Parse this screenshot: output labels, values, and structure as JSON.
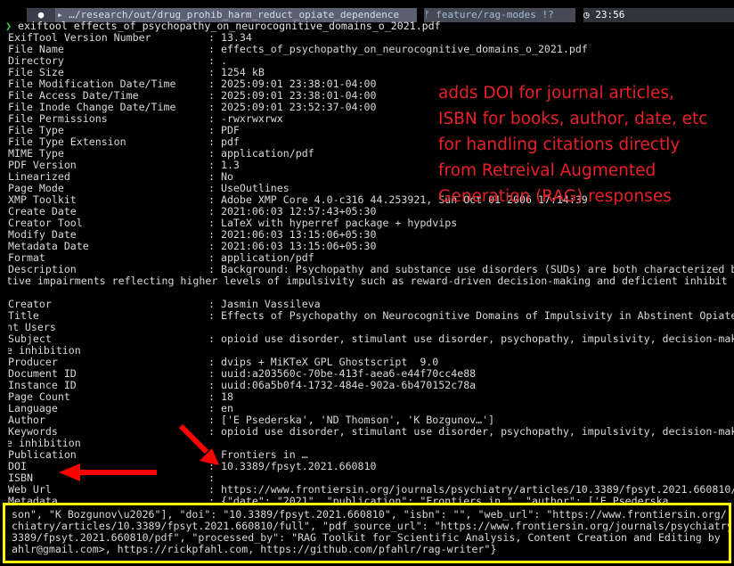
{
  "prompt_bar": {
    "os_icon": "apple-icon",
    "path": "…/research/out/drug_prohib_harm_reduct_opiate_dependence",
    "git": "feature/rag-modes !?",
    "git_icon": "branch-icon",
    "time": "23:56",
    "clock_icon": "clock-icon"
  },
  "command": {
    "prompt_char": "❯",
    "text": "exiftool effects_of_psychopathy_on_neurocognitive_domains_o_2021.pdf"
  },
  "rows": [
    {
      "key": "ExifTool Version Number",
      "value": "13.34"
    },
    {
      "key": "File Name",
      "value": "effects_of_psychopathy_on_neurocognitive_domains_o_2021.pdf"
    },
    {
      "key": "Directory",
      "value": "."
    },
    {
      "key": "File Size",
      "value": "1254 kB"
    },
    {
      "key": "File Modification Date/Time",
      "value": "2025:09:01 23:38:01-04:00"
    },
    {
      "key": "File Access Date/Time",
      "value": "2025:09:01 23:38:01-04:00"
    },
    {
      "key": "File Inode Change Date/Time",
      "value": "2025:09:01 23:52:37-04:00"
    },
    {
      "key": "File Permissions",
      "value": "-rwxrwxrwx"
    },
    {
      "key": "File Type",
      "value": "PDF"
    },
    {
      "key": "File Type Extension",
      "value": "pdf"
    },
    {
      "key": "MIME Type",
      "value": "application/pdf"
    },
    {
      "key": "PDF Version",
      "value": "1.3"
    },
    {
      "key": "Linearized",
      "value": "No"
    },
    {
      "key": "Page Mode",
      "value": "UseOutlines"
    },
    {
      "key": "XMP Toolkit",
      "value": "Adobe XMP Core 4.0-c316 44.253921, Sun Oct 01 2006 17:14:39"
    },
    {
      "key": "Create Date",
      "value": "2021:06:03 12:57:43+05:30"
    },
    {
      "key": "Creator Tool",
      "value": "LaTeX with hyperref package + hypdvips"
    },
    {
      "key": "Modify Date",
      "value": "2021:06:03 13:15:06+05:30"
    },
    {
      "key": "Metadata Date",
      "value": "2021:06:03 13:15:06+05:30"
    },
    {
      "key": "Format",
      "value": "application/pdf"
    },
    {
      "key": "Description",
      "value": "Background: Psychopathy and substance use disorders (SUDs) are both characterized b",
      "wrap": [
        "itive impairments reflecting higher levels of impulsivity such as reward-driven decision-making and deficient inhibit",
        "."
      ]
    },
    {
      "key": "Creator",
      "value": "Jasmin Vassileva"
    },
    {
      "key": "Title",
      "value": "Effects of Psychopathy on Neurocognitive Domains of Impulsivity in Abstinent Opiate",
      "wrap": [
        "ant Users"
      ]
    },
    {
      "key": "Subject",
      "value": "opioid use disorder, stimulant use disorder, psychopathy, impulsivity, decision-mak",
      "wrap": [
        "se inhibition"
      ]
    },
    {
      "key": "Producer",
      "value": "dvips + MiKTeX GPL Ghostscript  9.0"
    },
    {
      "key": "Document ID",
      "value": "uuid:a203560c-70be-413f-aea6-e44f70cc4e88"
    },
    {
      "key": "Instance ID",
      "value": "uuid:06a5b0f4-1732-484e-902a-6b470152c78a"
    },
    {
      "key": "Page Count",
      "value": "18"
    },
    {
      "key": "Language",
      "value": "en"
    },
    {
      "key": "Author",
      "value": "['E Psederska', 'ND Thomson', 'K Bozgunov…']"
    },
    {
      "key": "Keywords",
      "value": "opioid use disorder, stimulant use disorder, psychopathy, impulsivity, decision-mak",
      "wrap": [
        "se inhibition"
      ]
    },
    {
      "key": "Publication",
      "value": "Frontiers in …"
    },
    {
      "key": "DOI",
      "value": "10.3389/fpsyt.2021.660810"
    },
    {
      "key": "ISBN",
      "value": ""
    },
    {
      "key": "Web Url",
      "value": "https://www.frontiersin.org/journals/psychiatry/articles/10.3389/fpsyt.2021.660810/"
    },
    {
      "key": "Metadata",
      "value": "{\"date\": \"2021\", \"publication\": \"Frontiers in…\", \"author\": ['E Psederska"
    }
  ],
  "yellow_box_lines": [
    "son\", \"K Bozgunov\\u2026\"], \"doi\": \"10.3389/fpsyt.2021.660810\", \"isbn\": \"\", \"web_url\": \"https://www.frontiersin.org/",
    "chiatry/articles/10.3389/fpsyt.2021.660810/full\", \"pdf_source_url\": \"https://www.frontiersin.org/journals/psychiatry",
    "3389/fpsyt.2021.660810/pdf\", \"processed_by\": \"RAG Toolkit for Scientific Analysis, Content Creation and Editing by",
    "ahlr@gmail.com>, https://rickpfahl.com, https://github.com/pfahlr/rag-writer\"}"
  ],
  "annotation_lines": [
    "adds DOI for journal articles,",
    "ISBN for books, author, date, etc",
    "for handling citations directly",
    "from Retreival Augmented",
    "Generation (RAG) responses"
  ],
  "colors": {
    "annotation": "#e8202a",
    "highlight_box": "#ffff00",
    "arrow": "#ff0000",
    "prompt_char": "#39d353"
  }
}
